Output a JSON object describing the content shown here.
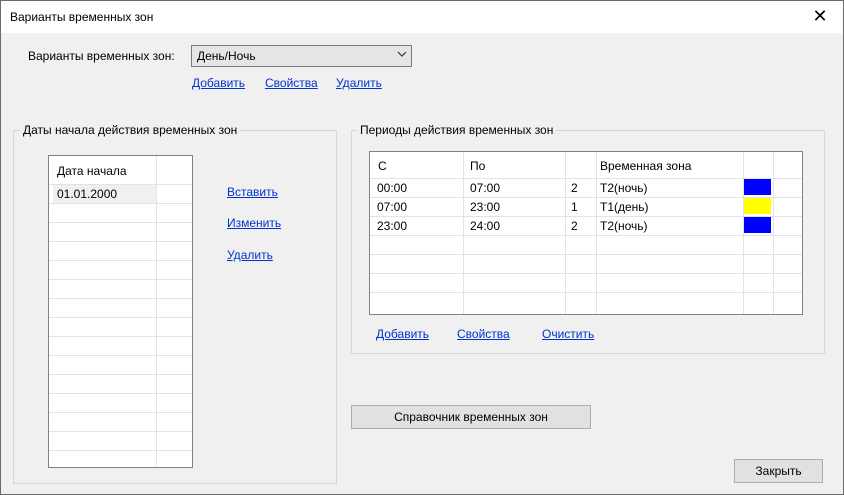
{
  "window": {
    "title": "Варианты временных зон",
    "close_glyph": "✕"
  },
  "variants": {
    "label": "Варианты временных зон:",
    "selected": "День/Ночь",
    "links": {
      "add": "Добавить",
      "props": "Свойства",
      "delete": "Удалить"
    }
  },
  "dates_group": {
    "title": "Даты начала действия временных зон",
    "header": "Дата начала",
    "rows": [
      "01.01.2000"
    ],
    "links": {
      "insert": "Вставить",
      "edit": "Изменить",
      "delete": "Удалить"
    }
  },
  "periods_group": {
    "title": "Периоды действия временных зон",
    "headers": {
      "from": "С",
      "to": "По",
      "num": "",
      "zone": "Временная зона",
      "color": ""
    },
    "rows": [
      {
        "from": "00:00",
        "to": "07:00",
        "num": "2",
        "zone": "T2(ночь)",
        "color": "#0000ff"
      },
      {
        "from": "07:00",
        "to": "23:00",
        "num": "1",
        "zone": "T1(день)",
        "color": "#ffff00"
      },
      {
        "from": "23:00",
        "to": "24:00",
        "num": "2",
        "zone": "T2(ночь)",
        "color": "#0000ff"
      }
    ],
    "links": {
      "add": "Добавить",
      "props": "Свойства",
      "clear": "Очистить"
    }
  },
  "buttons": {
    "reference": "Справочник временных зон",
    "close": "Закрыть"
  }
}
